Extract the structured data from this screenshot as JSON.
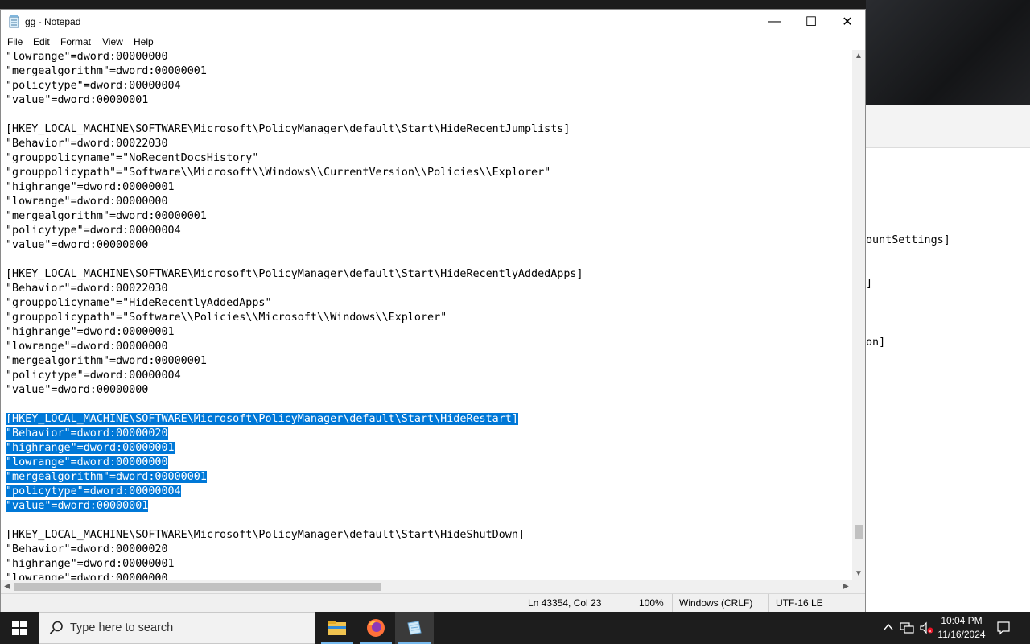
{
  "window": {
    "title": "gg - Notepad",
    "minimize_glyph": "—",
    "maximize_glyph": "☐",
    "close_glyph": "✕"
  },
  "menu": {
    "file": "File",
    "edit": "Edit",
    "format": "Format",
    "view": "View",
    "help": "Help"
  },
  "editor": {
    "lines": [
      "\"lowrange\"=dword:00000000",
      "\"mergealgorithm\"=dword:00000001",
      "\"policytype\"=dword:00000004",
      "\"value\"=dword:00000001",
      "",
      "[HKEY_LOCAL_MACHINE\\SOFTWARE\\Microsoft\\PolicyManager\\default\\Start\\HideRecentJumplists]",
      "\"Behavior\"=dword:00022030",
      "\"grouppolicyname\"=\"NoRecentDocsHistory\"",
      "\"grouppolicypath\"=\"Software\\\\Microsoft\\\\Windows\\\\CurrentVersion\\\\Policies\\\\Explorer\"",
      "\"highrange\"=dword:00000001",
      "\"lowrange\"=dword:00000000",
      "\"mergealgorithm\"=dword:00000001",
      "\"policytype\"=dword:00000004",
      "\"value\"=dword:00000000",
      "",
      "[HKEY_LOCAL_MACHINE\\SOFTWARE\\Microsoft\\PolicyManager\\default\\Start\\HideRecentlyAddedApps]",
      "\"Behavior\"=dword:00022030",
      "\"grouppolicyname\"=\"HideRecentlyAddedApps\"",
      "\"grouppolicypath\"=\"Software\\\\Policies\\\\Microsoft\\\\Windows\\\\Explorer\"",
      "\"highrange\"=dword:00000001",
      "\"lowrange\"=dword:00000000",
      "\"mergealgorithm\"=dword:00000001",
      "\"policytype\"=dword:00000004",
      "\"value\"=dword:00000000",
      "",
      "[HKEY_LOCAL_MACHINE\\SOFTWARE\\Microsoft\\PolicyManager\\default\\Start\\HideRestart]",
      "\"Behavior\"=dword:00000020",
      "\"highrange\"=dword:00000001",
      "\"lowrange\"=dword:00000000",
      "\"mergealgorithm\"=dword:00000001",
      "\"policytype\"=dword:00000004",
      "\"value\"=dword:00000001",
      "",
      "[HKEY_LOCAL_MACHINE\\SOFTWARE\\Microsoft\\PolicyManager\\default\\Start\\HideShutDown]",
      "\"Behavior\"=dword:00000020",
      "\"highrange\"=dword:00000001",
      "\"lowrange\"=dword:00000000"
    ],
    "selection": {
      "first_line": 25,
      "last_line": 31
    },
    "selection_color": "#0078d7"
  },
  "status": {
    "position": "Ln 43354, Col 23",
    "zoom": "100%",
    "line_endings": "Windows (CRLF)",
    "encoding": "UTF-16 LE"
  },
  "background_window": {
    "fragments": [
      "ountSettings]",
      "]",
      "on]"
    ]
  },
  "taskbar": {
    "search_placeholder": "Type here to search",
    "time": "10:04 PM",
    "date": "11/16/2024",
    "apps": [
      "file-explorer",
      "firefox",
      "notepad"
    ]
  }
}
